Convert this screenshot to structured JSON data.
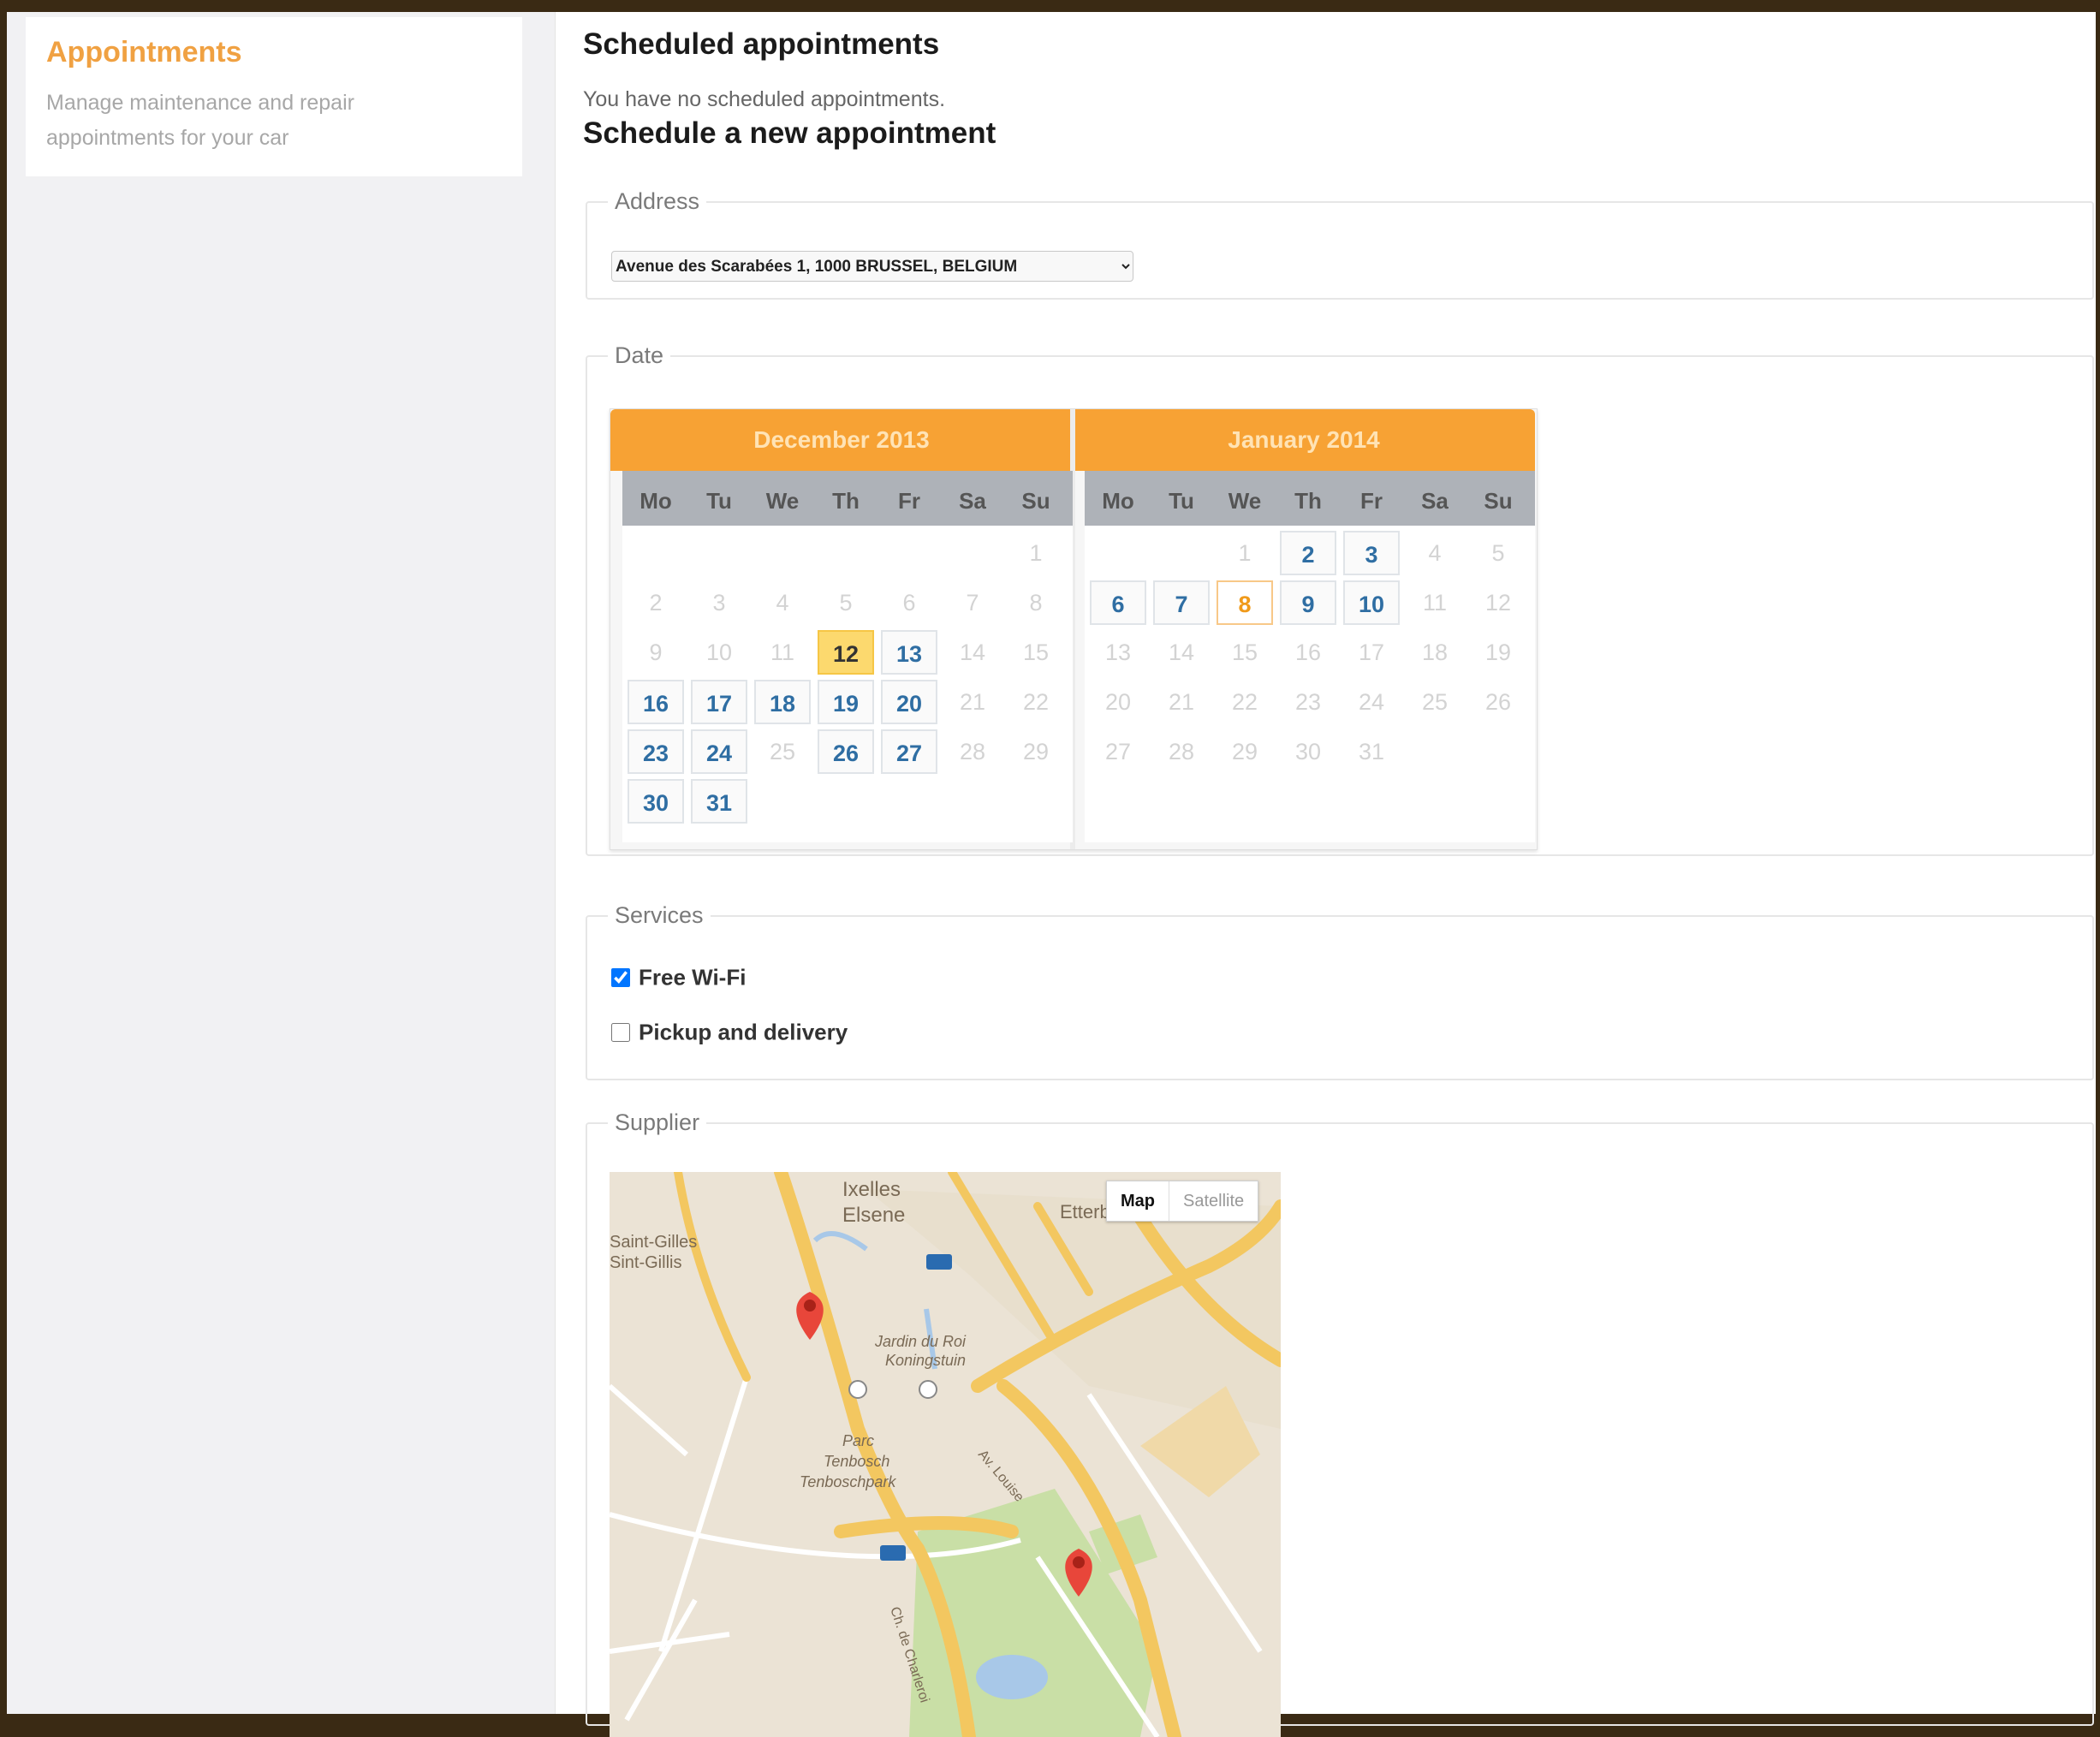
{
  "sidebar": {
    "title": "Appointments",
    "description": "Manage maintenance and repair appointments for your car"
  },
  "main": {
    "scheduled_title": "Scheduled appointments",
    "no_appointments": "You have no scheduled appointments.",
    "new_title": "Schedule a new appointment"
  },
  "address": {
    "legend": "Address",
    "selected": "Avenue des Scarabées 1, 1000 BRUSSEL, BELGIUM"
  },
  "date": {
    "legend": "Date",
    "months": [
      {
        "name": "December 2013",
        "weekdays": [
          "Mo",
          "Tu",
          "We",
          "Th",
          "Fr",
          "Sa",
          "Su"
        ],
        "weeks": [
          [
            "",
            "",
            "",
            "",
            "",
            "",
            "1"
          ],
          [
            "2",
            "3",
            "4",
            "5",
            "6",
            "7",
            "8"
          ],
          [
            "9",
            "10",
            "11",
            "12",
            "13",
            "14",
            "15"
          ],
          [
            "16",
            "17",
            "18",
            "19",
            "20",
            "21",
            "22"
          ],
          [
            "23",
            "24",
            "25",
            "26",
            "27",
            "28",
            "29"
          ],
          [
            "30",
            "31",
            "",
            "",
            "",
            "",
            ""
          ]
        ],
        "available": [
          "13",
          "16",
          "17",
          "18",
          "19",
          "20",
          "23",
          "24",
          "26",
          "27",
          "30",
          "31"
        ],
        "today": "12"
      },
      {
        "name": "January 2014",
        "weekdays": [
          "Mo",
          "Tu",
          "We",
          "Th",
          "Fr",
          "Sa",
          "Su"
        ],
        "weeks": [
          [
            "",
            "",
            "1",
            "2",
            "3",
            "4",
            "5"
          ],
          [
            "6",
            "7",
            "8",
            "9",
            "10",
            "11",
            "12"
          ],
          [
            "13",
            "14",
            "15",
            "16",
            "17",
            "18",
            "19"
          ],
          [
            "20",
            "21",
            "22",
            "23",
            "24",
            "25",
            "26"
          ],
          [
            "27",
            "28",
            "29",
            "30",
            "31",
            "",
            ""
          ]
        ],
        "available": [
          "2",
          "3",
          "6",
          "7",
          "9",
          "10"
        ],
        "selected": "8"
      }
    ]
  },
  "services": {
    "legend": "Services",
    "items": [
      {
        "label": "Free Wi-Fi",
        "checked": true
      },
      {
        "label": "Pickup and delivery",
        "checked": false
      }
    ]
  },
  "supplier": {
    "legend": "Supplier",
    "map_type_options": [
      "Map",
      "Satellite"
    ],
    "map_labels": {
      "district_1": "Ixelles",
      "district_2": "Elsene",
      "district_3": "Saint-Gilles",
      "district_3b": "Sint-Gillis",
      "garden_1": "Jardin du Roi",
      "garden_2": "Koningstuin",
      "park_1": "Parc",
      "park_2": "Tenbosch",
      "park_3": "Tenboschpark",
      "road_1": "Ch. de Charleroi",
      "road_2": "Av. Louise",
      "edge": "Etterbeek"
    },
    "colors": {
      "road_major": "#f3c760",
      "park": "#c9dfa6",
      "marker": "#e8463a"
    }
  },
  "theme": {
    "accent": "#f7a234",
    "today": "#fcd96e",
    "available_text": "#2f6ea3"
  }
}
